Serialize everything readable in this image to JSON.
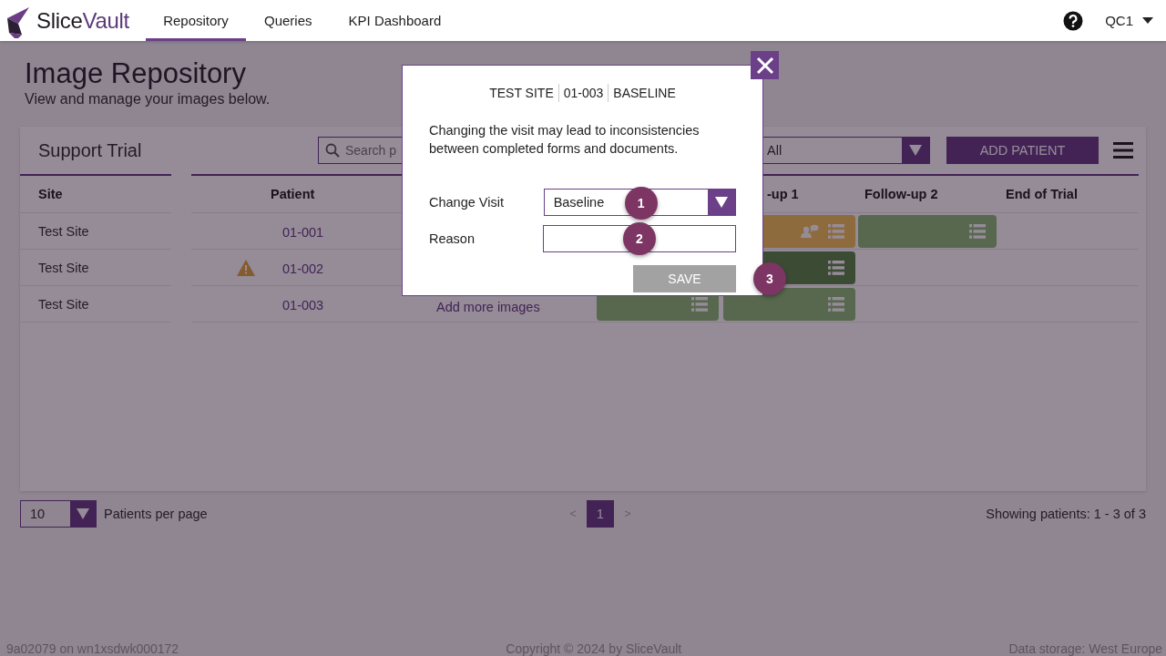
{
  "nav": {
    "logo": [
      "Slice",
      "Vault"
    ],
    "tabs": [
      {
        "label": "Repository",
        "selected": true
      },
      {
        "label": "Queries",
        "selected": false
      },
      {
        "label": "KPI Dashboard",
        "selected": false
      }
    ],
    "user": "QC1"
  },
  "page": {
    "title": "Image Repository",
    "subtitle": "View and manage your images below."
  },
  "card": {
    "trial": "Support Trial",
    "search": {
      "placeholder": "Search p"
    },
    "filter": {
      "value": "All"
    },
    "add_button": "ADD PATIENT",
    "columns": {
      "site": "Site",
      "patient": "Patient",
      "visits": [
        "-up 1",
        "Follow-up 2",
        "End of Trial"
      ]
    },
    "rows": [
      {
        "site": "Test Site",
        "warning": false,
        "patient": "01-001",
        "visits": [
          {
            "kind": "empty"
          },
          {
            "kind": "pending",
            "comment": true
          },
          {
            "kind": "complete",
            "comment": false
          },
          {
            "kind": "empty"
          }
        ]
      },
      {
        "site": "Test Site",
        "warning": true,
        "patient": "01-002",
        "visits": [
          {
            "kind": "empty"
          },
          {
            "kind": "approved",
            "comment": false
          },
          {
            "kind": "empty"
          },
          {
            "kind": "empty"
          }
        ]
      },
      {
        "site": "Test Site",
        "warning": false,
        "patient": "01-003",
        "link": "Add more images",
        "visits": [
          {
            "kind": "complete",
            "comment": false
          },
          {
            "kind": "complete",
            "comment": false
          },
          {
            "kind": "empty"
          },
          {
            "kind": "empty"
          }
        ]
      }
    ]
  },
  "pagination": {
    "per_page": "10",
    "per_page_label": "Patients per page",
    "pages": [
      {
        "label": "<",
        "kind": "prev",
        "disabled": true,
        "selected": false
      },
      {
        "label": "1",
        "kind": "page",
        "disabled": false,
        "selected": true
      },
      {
        "label": ">",
        "kind": "next",
        "disabled": true,
        "selected": false
      }
    ],
    "summary": "Showing patients: 1 - 3 of 3"
  },
  "footer": [
    "9a02079 on wn1xsdwk000172",
    "Copyright © 2024 by SliceVault",
    "Data storage: West Europe"
  ],
  "modal": {
    "header": [
      "TEST SITE",
      "01-003",
      "BASELINE"
    ],
    "message": "Changing the visit may lead to inconsistencies between completed forms and documents.",
    "fields": [
      {
        "label": "Change Visit",
        "kind": "select",
        "value": "Baseline",
        "step": "1"
      },
      {
        "label": "Reason",
        "kind": "text",
        "step": "2"
      }
    ],
    "save": {
      "label": "SAVE",
      "disabled": true,
      "step": "3"
    }
  }
}
